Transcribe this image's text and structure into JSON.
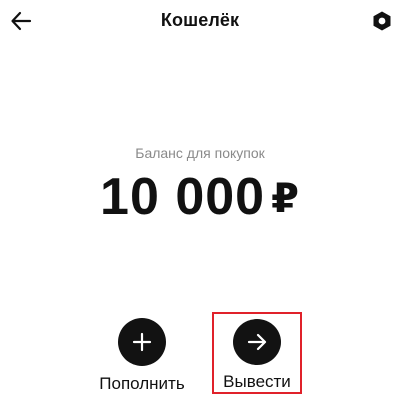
{
  "header": {
    "title": "Кошелёк",
    "back_icon": "arrow-left-icon",
    "settings_icon": "hexagon-settings-icon"
  },
  "balance": {
    "label": "Баланс для покупок",
    "amount": "10 000",
    "currency": "₽"
  },
  "actions": [
    {
      "label": "Пополнить",
      "icon": "plus-icon"
    },
    {
      "label": "Вывести",
      "icon": "arrow-right-icon",
      "highlighted": true
    }
  ],
  "colors": {
    "button_bg": "#121212",
    "highlight_border": "#e0212a",
    "label_gray": "#8a8a8a"
  }
}
